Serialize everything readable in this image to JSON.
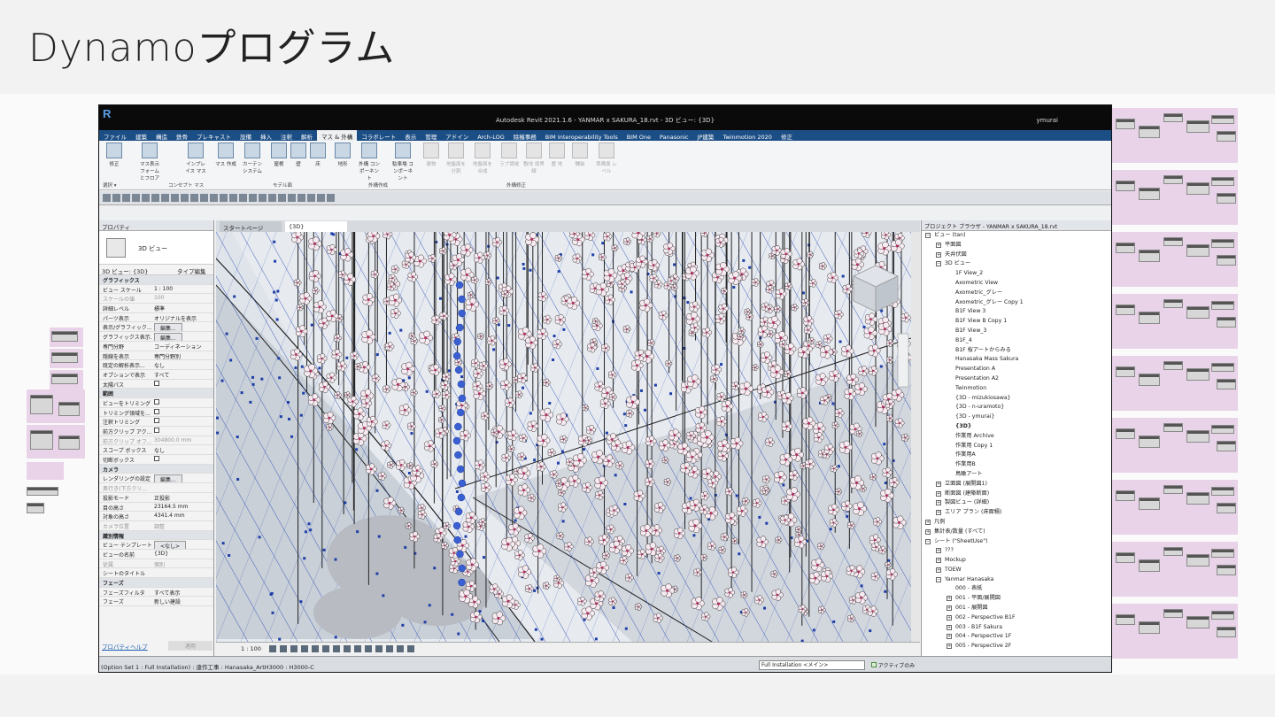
{
  "slide": {
    "title": "Dynamoプログラム"
  },
  "revit": {
    "window_title": "Autodesk Revit 2021.1.6 - YANMAR x SAKURA_18.rvt - 3D ビュー: {3D}",
    "user": "ymurai",
    "menu": [
      "ファイル",
      "建築",
      "構造",
      "鉄骨",
      "プレキャスト",
      "設備",
      "挿入",
      "注釈",
      "解析",
      "マス & 外構",
      "コラボレート",
      "表示",
      "管理",
      "アドイン",
      "Arch-LOG",
      "除擁事務",
      "BIM Interoperability Tools",
      "BIM One",
      "Panasonic",
      "JP建築",
      "Twinmotion 2020",
      "修正"
    ],
    "active_menu_index": 9,
    "ribbon": {
      "buttons": [
        {
          "label": "修正",
          "dim": false
        },
        {
          "label": "マス表示 フォームとフロア",
          "dim": false
        },
        {
          "label": "インプレイス マス",
          "dim": false
        },
        {
          "label": "マス 作成",
          "dim": false
        },
        {
          "label": "カーテン システム",
          "dim": false
        },
        {
          "label": "屋根",
          "dim": false
        },
        {
          "label": "壁",
          "dim": false
        },
        {
          "label": "床",
          "dim": false
        },
        {
          "label": "地形",
          "dim": false
        },
        {
          "label": "外構 コンポーネント",
          "dim": false
        },
        {
          "label": "駐車場 コンポーネント",
          "dim": false
        },
        {
          "label": "建物",
          "dim": true
        },
        {
          "label": "地盤面を 分割",
          "dim": true
        },
        {
          "label": "地盤面を 合成",
          "dim": true
        },
        {
          "label": "ラブ領域",
          "dim": true
        },
        {
          "label": "敷地 境界線",
          "dim": true
        },
        {
          "label": "整 地",
          "dim": true
        },
        {
          "label": "舗装",
          "dim": true
        },
        {
          "label": "準備面 レベル",
          "dim": true
        }
      ],
      "groups": [
        "選択 ▾",
        "コンセプト マス",
        "モデル面",
        "外構作成",
        "外構修正"
      ]
    },
    "properties": {
      "header": "プロパティ",
      "type_name": "3D ビュー",
      "selector": "3D ビュー: {3D}",
      "edit_type": "タイプ編集",
      "rows": [
        {
          "k": "グラフィックス",
          "v": "",
          "sec": true
        },
        {
          "k": "ビュー スケール",
          "v": "1 : 100"
        },
        {
          "k": "スケールの値",
          "v": "100",
          "grey": true
        },
        {
          "k": "詳細レベル",
          "v": "標準"
        },
        {
          "k": "パーツ表示",
          "v": "オリジナルを表示"
        },
        {
          "k": "表示/グラフィック...",
          "v": "編集...",
          "btn": true
        },
        {
          "k": "グラフィックス表示...",
          "v": "編集...",
          "btn": true
        },
        {
          "k": "専門分野",
          "v": "コーディネーション"
        },
        {
          "k": "隠線を表示",
          "v": "専門分野別"
        },
        {
          "k": "既定の解析表示...",
          "v": "なし"
        },
        {
          "k": "オプションで表示",
          "v": "すべて"
        },
        {
          "k": "太陽パス",
          "v": "",
          "check": true
        },
        {
          "k": "範囲",
          "v": "",
          "sec": true
        },
        {
          "k": "ビューをトリミング",
          "v": "",
          "check": true
        },
        {
          "k": "トリミング領域を...",
          "v": "",
          "check": true
        },
        {
          "k": "注釈トリミング",
          "v": "",
          "check": true
        },
        {
          "k": "前方クリップ アク...",
          "v": "",
          "check": true
        },
        {
          "k": "前方クリップ オフ...",
          "v": "304800.0 mm",
          "grey": true
        },
        {
          "k": "スコープ ボックス",
          "v": "なし"
        },
        {
          "k": "切断ボックス",
          "v": "",
          "check": true
        },
        {
          "k": "カメラ",
          "v": "",
          "sec": true
        },
        {
          "k": "レンダリングの設定",
          "v": "編集...",
          "btn": true
        },
        {
          "k": "奥行き(下方クリ...",
          "v": "",
          "grey": true
        },
        {
          "k": "投影モード",
          "v": "正投影"
        },
        {
          "k": "目の高さ",
          "v": "23164.5 mm"
        },
        {
          "k": "対象の高さ",
          "v": "4341.4 mm"
        },
        {
          "k": "カメラ位置",
          "v": "調整",
          "grey": true
        },
        {
          "k": "識別情報",
          "v": "",
          "sec": true
        },
        {
          "k": "ビュー テンプレート",
          "v": "<なし>",
          "btn": true
        },
        {
          "k": "ビューの名前",
          "v": "{3D}"
        },
        {
          "k": "従属",
          "v": "個別",
          "grey": true
        },
        {
          "k": "シートのタイトル",
          "v": ""
        },
        {
          "k": "フェーズ",
          "v": "",
          "sec": true
        },
        {
          "k": "フェーズフィルタ",
          "v": "すべて表示"
        },
        {
          "k": "フェーズ",
          "v": "新しい建設"
        }
      ],
      "help": "プロパティヘルプ",
      "apply": "適用"
    },
    "tabs": [
      {
        "label": "スタートページ",
        "active": false
      },
      {
        "label": "{3D}",
        "active": true
      }
    ],
    "view_scale": "1 : 100",
    "browser": {
      "header": "プロジェクト ブラウザ - YANMAR x SAKURA_18.rvt",
      "items": [
        {
          "t": "ビュー (tan)",
          "lv": 0,
          "tg": "−"
        },
        {
          "t": "平面図",
          "lv": 1,
          "tg": "+"
        },
        {
          "t": "天井伏図",
          "lv": 1,
          "tg": "+"
        },
        {
          "t": "3D ビュー",
          "lv": 1,
          "tg": "−"
        },
        {
          "t": "1F View_2",
          "lv": 2
        },
        {
          "t": "Axometric View",
          "lv": 2
        },
        {
          "t": "Axometric_グレー",
          "lv": 2
        },
        {
          "t": "Axometric_グレー Copy 1",
          "lv": 2
        },
        {
          "t": "B1F View 3",
          "lv": 2
        },
        {
          "t": "B1F View B Copy 1",
          "lv": 2
        },
        {
          "t": "B1F View_3",
          "lv": 2
        },
        {
          "t": "B1F_4",
          "lv": 2
        },
        {
          "t": "B1F 桜アートからみる",
          "lv": 2
        },
        {
          "t": "Hanasaka Mass Sakura",
          "lv": 2
        },
        {
          "t": "Presentation A",
          "lv": 2
        },
        {
          "t": "Presentation A2",
          "lv": 2
        },
        {
          "t": "Twinmotion",
          "lv": 2
        },
        {
          "t": "{3D - mizukiosawa}",
          "lv": 2
        },
        {
          "t": "{3D - n-uramoto}",
          "lv": 2
        },
        {
          "t": "{3D - ymurai}",
          "lv": 2
        },
        {
          "t": "{3D}",
          "lv": 2,
          "bold": true
        },
        {
          "t": "作業用 Archive",
          "lv": 2
        },
        {
          "t": "作業用 Copy 1",
          "lv": 2
        },
        {
          "t": "作業用A",
          "lv": 2
        },
        {
          "t": "作業用B",
          "lv": 2
        },
        {
          "t": "鳥瞰アート",
          "lv": 2
        },
        {
          "t": "立面図 (展開図1)",
          "lv": 1,
          "tg": "+"
        },
        {
          "t": "断面図 (建築断面)",
          "lv": 1,
          "tg": "+"
        },
        {
          "t": "製図ビュー (詳細)",
          "lv": 1,
          "tg": "+"
        },
        {
          "t": "エリア プラン (床面積)",
          "lv": 1,
          "tg": "+"
        },
        {
          "t": "凡例",
          "lv": 0,
          "tg": "+"
        },
        {
          "t": "集計表/数量 (すべて)",
          "lv": 0,
          "tg": "+"
        },
        {
          "t": "シート (\"SheetUse\")",
          "lv": 0,
          "tg": "−"
        },
        {
          "t": "???",
          "lv": 1,
          "tg": "+"
        },
        {
          "t": "Mockup",
          "lv": 1,
          "tg": "+"
        },
        {
          "t": "TOEW",
          "lv": 1,
          "tg": "+"
        },
        {
          "t": "Yanmar Hanasaka",
          "lv": 1,
          "tg": "−"
        },
        {
          "t": "000 - 表紙",
          "lv": 2
        },
        {
          "t": "001 - 平面/展開図",
          "lv": 2,
          "tg": "+"
        },
        {
          "t": "001 - 展開図",
          "lv": 2,
          "tg": "+"
        },
        {
          "t": "002 - Perspective B1F",
          "lv": 2,
          "tg": "+"
        },
        {
          "t": "003 - B1F Sakura",
          "lv": 2,
          "tg": "+"
        },
        {
          "t": "004 - Perspective 1F",
          "lv": 2,
          "tg": "+"
        },
        {
          "t": "005 - Perspective 2F",
          "lv": 2,
          "tg": "+"
        }
      ]
    },
    "status": {
      "text": "(Option Set 1 : Full Installation) : 遠作工事 : Hanasaka_ArtH3000 : H3000-C",
      "option": "Full Installation <メイン>",
      "active_only": "アクティブのみ"
    }
  },
  "colors": {
    "menubar": "#1c4e86",
    "dynamo_pink": "#e8d3e8",
    "petal": "#f7eaf0",
    "grid_blue": "#1f3fa8"
  }
}
